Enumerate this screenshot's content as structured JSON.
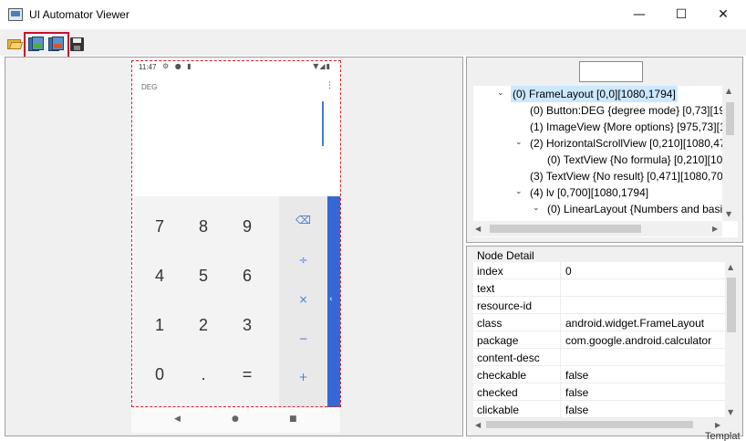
{
  "window": {
    "title": "UI Automator Viewer",
    "min_glyph": "—",
    "max_glyph": "☐",
    "close_glyph": "✕"
  },
  "toolbar": {
    "icons": [
      "open-folder-icon",
      "device-screenshot-icon",
      "device-screenshot-compressed-icon",
      "save-icon"
    ]
  },
  "device": {
    "status_time": "11:47",
    "status_icons": "⚙ ● ▮",
    "status_right": "▼◢▮",
    "mode_label": "DEG",
    "overflow_glyph": "⋮",
    "keys": [
      [
        "7",
        "8",
        "9"
      ],
      [
        "4",
        "5",
        "6"
      ],
      [
        "1",
        "2",
        "3"
      ],
      [
        "0",
        ".",
        "="
      ]
    ],
    "ops": [
      "⌫",
      "÷",
      "×",
      "−",
      "+"
    ],
    "drawer_glyph": "‹",
    "nav": [
      "◀",
      "●",
      "■"
    ]
  },
  "hierarchy": {
    "search_value": "",
    "nodes": [
      {
        "label": "(0) FrameLayout [0,0][1080,1794]",
        "twisty": "⌄",
        "selected": true
      },
      {
        "label": "(0) Button:DEG {degree mode} [0,73][194",
        "twisty": ""
      },
      {
        "label": "(1) ImageView {More options} [975,73][1",
        "twisty": ""
      },
      {
        "label": "(2) HorizontalScrollView [0,210][1080,47",
        "twisty": "⌄"
      },
      {
        "label": "(0) TextView {No formula} [0,210][10",
        "twisty": ""
      },
      {
        "label": "(3) TextView {No result} [0,471][1080,700",
        "twisty": ""
      },
      {
        "label": "(4) lv [0,700][1080,1794]",
        "twisty": "⌄"
      },
      {
        "label": "(0) LinearLayout {Numbers and basic",
        "twisty": "⌄"
      }
    ]
  },
  "detail": {
    "title": "Node Detail",
    "rows": [
      {
        "key": "index",
        "value": "0"
      },
      {
        "key": "text",
        "value": ""
      },
      {
        "key": "resource-id",
        "value": ""
      },
      {
        "key": "class",
        "value": "android.widget.FrameLayout"
      },
      {
        "key": "package",
        "value": "com.google.android.calculator"
      },
      {
        "key": "content-desc",
        "value": ""
      },
      {
        "key": "checkable",
        "value": "false"
      },
      {
        "key": "checked",
        "value": "false"
      },
      {
        "key": "clickable",
        "value": "false"
      }
    ]
  },
  "background_text": "Templat"
}
